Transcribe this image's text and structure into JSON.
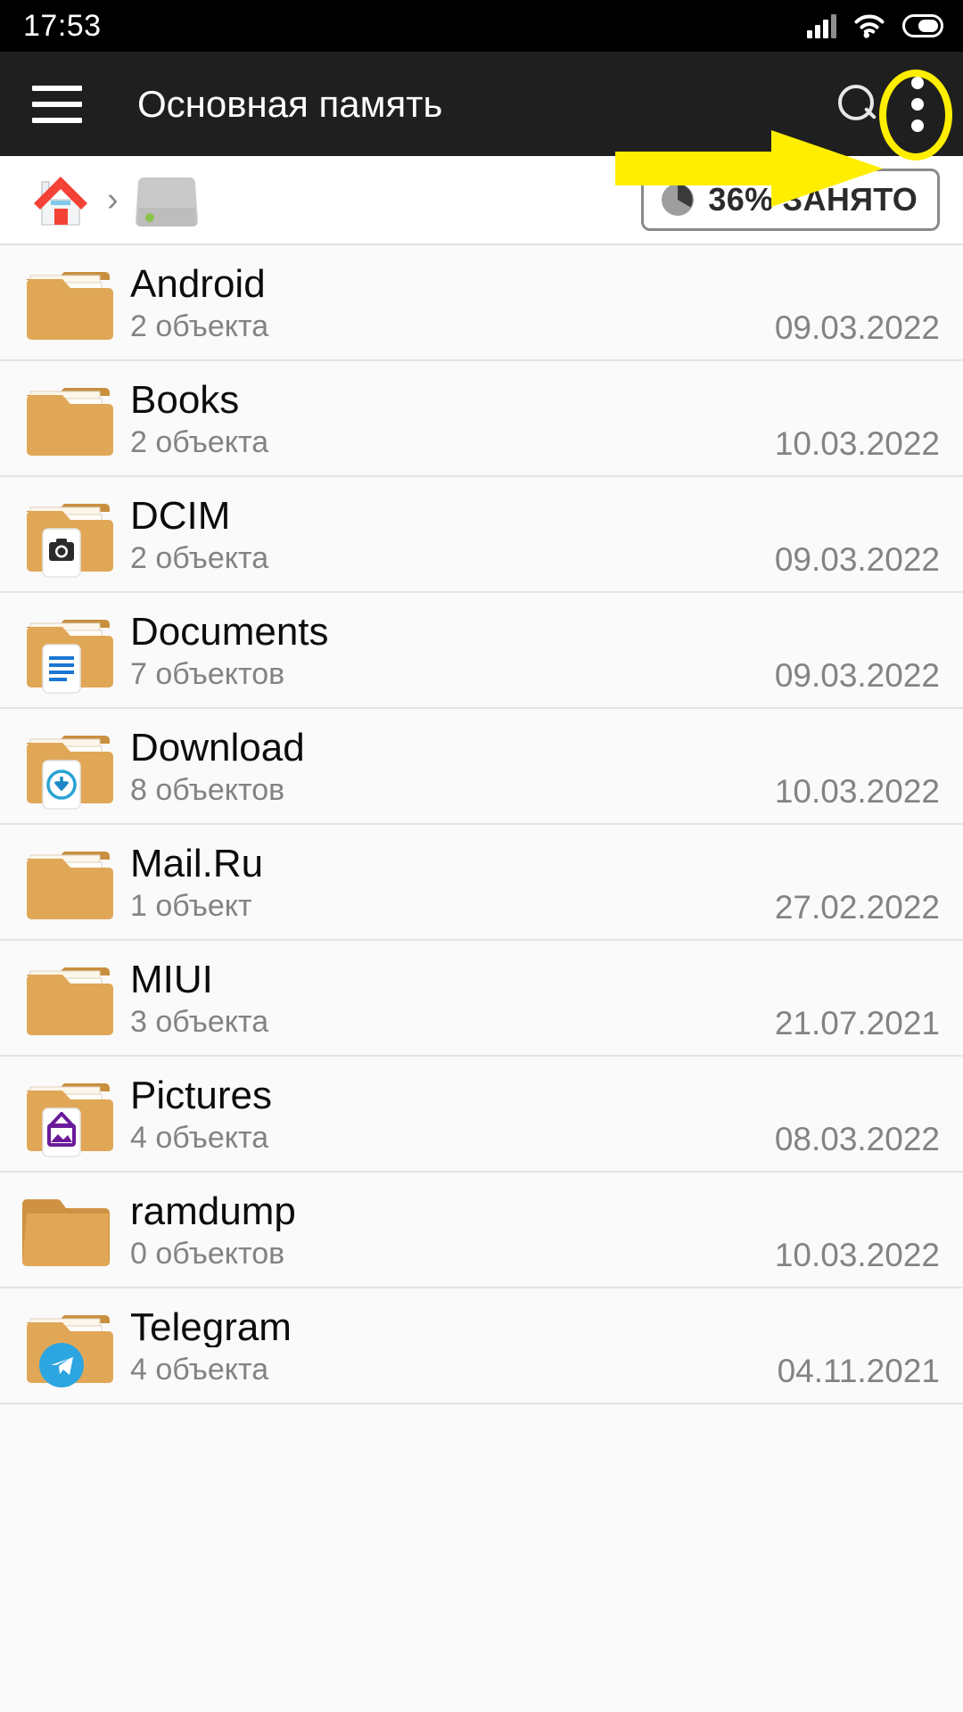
{
  "status_bar": {
    "time": "17:53",
    "icons": [
      "signal-bars-icon",
      "wifi-icon",
      "battery-icon"
    ]
  },
  "app_bar": {
    "menu_icon": "hamburger-menu-icon",
    "title": "Основная память",
    "search_icon": "search-icon",
    "overflow_icon": "overflow-menu-icon"
  },
  "annotations": {
    "arrow": {
      "color": "#ffee00",
      "points_to": "overflow-menu-icon"
    },
    "circle": {
      "color": "#ffee00",
      "around": "overflow-menu-icon"
    }
  },
  "breadcrumb": {
    "items": [
      {
        "icon": "home-icon",
        "label": ""
      },
      {
        "icon": "internal-storage-icon",
        "label": ""
      }
    ],
    "separator": "›"
  },
  "storage_badge": {
    "icon": "pie-chart-icon",
    "label": "36% ЗАНЯТО",
    "percent": 36
  },
  "files": [
    {
      "name": "Android",
      "count": "2 объекта",
      "date": "09.03.2022",
      "icon": "folder-icon"
    },
    {
      "name": "Books",
      "count": "2 объекта",
      "date": "10.03.2022",
      "icon": "folder-icon"
    },
    {
      "name": "DCIM",
      "count": "2 объекта",
      "date": "09.03.2022",
      "icon": "folder-camera-icon"
    },
    {
      "name": "Documents",
      "count": "7 объектов",
      "date": "09.03.2022",
      "icon": "folder-document-icon"
    },
    {
      "name": "Download",
      "count": "8 объектов",
      "date": "10.03.2022",
      "icon": "folder-download-icon"
    },
    {
      "name": "Mail.Ru",
      "count": "1 объект",
      "date": "27.02.2022",
      "icon": "folder-icon"
    },
    {
      "name": "MIUI",
      "count": "3 объекта",
      "date": "21.07.2021",
      "icon": "folder-icon"
    },
    {
      "name": "Pictures",
      "count": "4 объекта",
      "date": "08.03.2022",
      "icon": "folder-picture-icon"
    },
    {
      "name": "ramdump",
      "count": "0 объектов",
      "date": "10.03.2022",
      "icon": "folder-plain-icon"
    },
    {
      "name": "Telegram",
      "count": "4 объекта",
      "date": "04.11.2021",
      "icon": "folder-telegram-icon"
    }
  ],
  "colors": {
    "folder": "#e0a757",
    "appbar": "#1f1f1f",
    "annotation": "#ffee00",
    "list_bg": "#fafafa"
  }
}
